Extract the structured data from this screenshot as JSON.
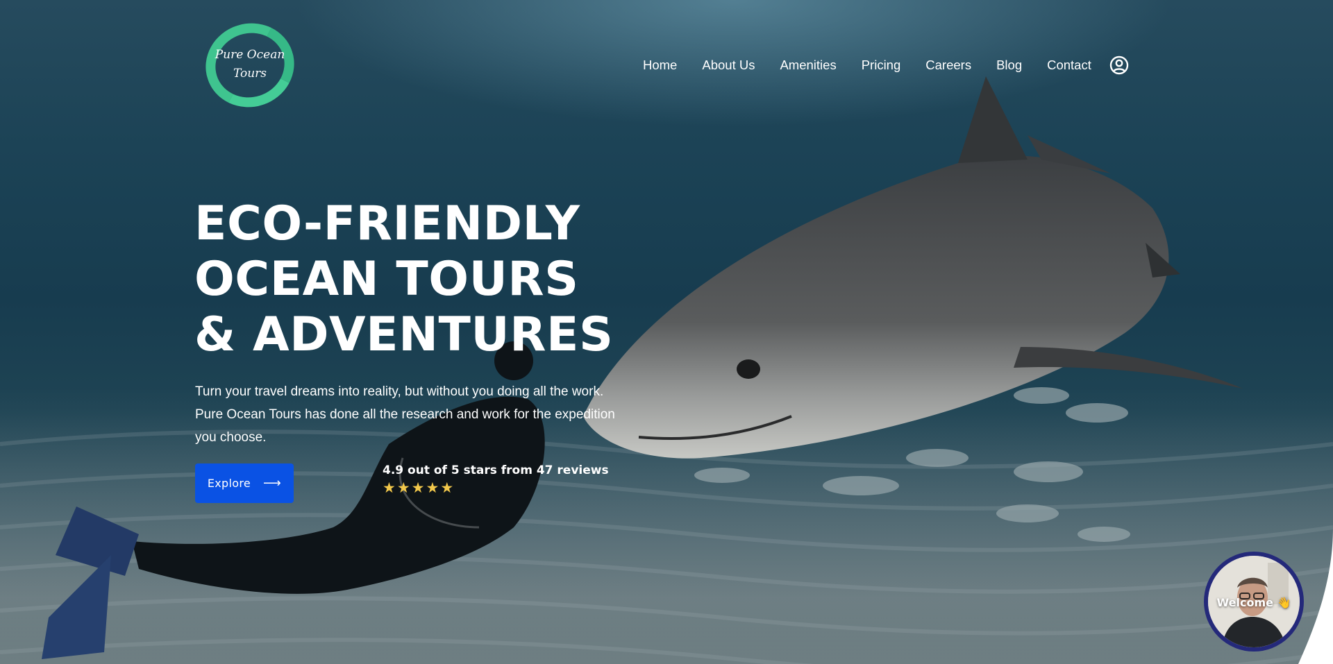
{
  "brand": {
    "logo_line1": "Pure Ocean",
    "logo_line2": "Tours",
    "ring_color": "#3fc48f"
  },
  "nav": {
    "items": [
      {
        "label": "Home"
      },
      {
        "label": "About Us"
      },
      {
        "label": "Amenities"
      },
      {
        "label": "Pricing"
      },
      {
        "label": "Careers"
      },
      {
        "label": "Blog"
      },
      {
        "label": "Contact"
      }
    ],
    "account_icon": "user-circle-icon"
  },
  "hero": {
    "title_lines": [
      "ECO-FRIENDLY",
      "OCEAN TOURS",
      "& ADVENTURES"
    ],
    "text_lines": [
      "Turn your travel dreams into reality, but without you doing all the work.",
      "Pure Ocean Tours has done all the research and work for the expedition",
      "you choose."
    ],
    "cta_label": "Explore",
    "cta_icon": "arrow-right-icon",
    "cta_color": "#0a52e4",
    "rating_text": "4.9 out of 5 stars from 47 reviews",
    "stars": [
      "★",
      "★",
      "★",
      "★",
      "★"
    ],
    "star_color": "#f2c84b",
    "star_rating": 5
  },
  "welcome_widget": {
    "label": "Welcome 👋",
    "border_color": "#24297a"
  }
}
